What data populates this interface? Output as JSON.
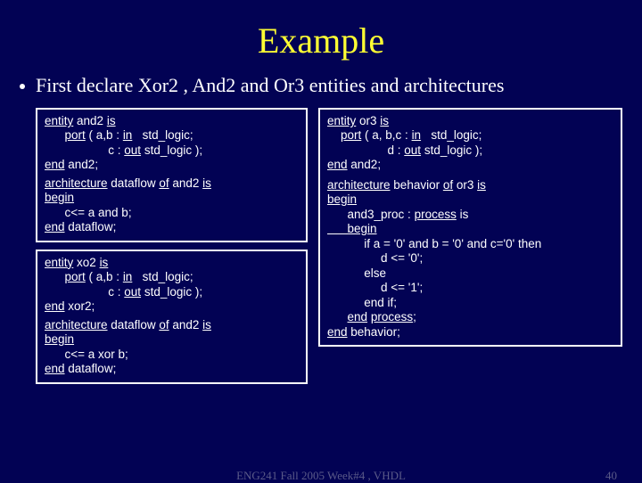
{
  "title": "Example",
  "bullet": "First declare Xor2 , And2 and Or3 entities and architectures",
  "box1": {
    "l1a": "entity",
    "l1b": " and2 ",
    "l1c": "is",
    "l2a": "      ",
    "l2b": "port",
    "l2c": " ( a,b : ",
    "l2d": "in",
    "l2e": "   std_logic;",
    "l3": "                   c : ",
    "l3b": "out",
    "l3c": " std_logic );",
    "l4a": "end",
    "l4b": " and2;",
    "l5a": "architecture",
    "l5b": " dataflow ",
    "l5c": "of",
    "l5d": " and2 ",
    "l5e": "is",
    "l6": "begin",
    "l7": "      c<= a and b;",
    "l8a": "end",
    "l8b": " dataflow;"
  },
  "box2": {
    "l1a": "entity",
    "l1b": " xo2 ",
    "l1c": "is",
    "l2a": "      ",
    "l2b": "port",
    "l2c": " ( a,b : ",
    "l2d": "in",
    "l2e": "   std_logic;",
    "l3": "                   c : ",
    "l3b": "out",
    "l3c": " std_logic );",
    "l4a": "end",
    "l4b": " xor2;",
    "l5a": "architecture",
    "l5b": " dataflow ",
    "l5c": "of",
    "l5d": " and2 ",
    "l5e": "is",
    "l6": "begin",
    "l7": "      c<= a xor b;",
    "l8a": "end",
    "l8b": " dataflow;"
  },
  "box3": {
    "l1a": "entity",
    "l1b": " or3 ",
    "l1c": "is",
    "l2a": "    ",
    "l2b": "port",
    "l2c": " ( a, b,c : ",
    "l2d": "in",
    "l2e": "   std_logic;",
    "l3": "                  d : ",
    "l3b": "out",
    "l3c": " std_logic );",
    "l4a": "end",
    "l4b": " and2;",
    "l5a": "architecture",
    "l5b": " behavior ",
    "l5c": "of",
    "l5d": " or3 ",
    "l5e": "is",
    "l6": "begin",
    "l7a": "      and3_proc : ",
    "l7b": "process",
    "l7c": " is",
    "l8": "      begin",
    "l9": "           if a = '0' and b = '0' and c='0' then",
    "l10": "                d <= '0';",
    "l11": "           else",
    "l12": "                d <= '1';",
    "l13": "           end if;",
    "l14a": "      ",
    "l14b": "end",
    "l14c": " ",
    "l14d": "process",
    "l14e": ";",
    "l15a": "end",
    "l15b": " behavior;"
  },
  "footer": {
    "center": "ENG241 Fall 2005 Week#4 , VHDL",
    "right": "40"
  }
}
